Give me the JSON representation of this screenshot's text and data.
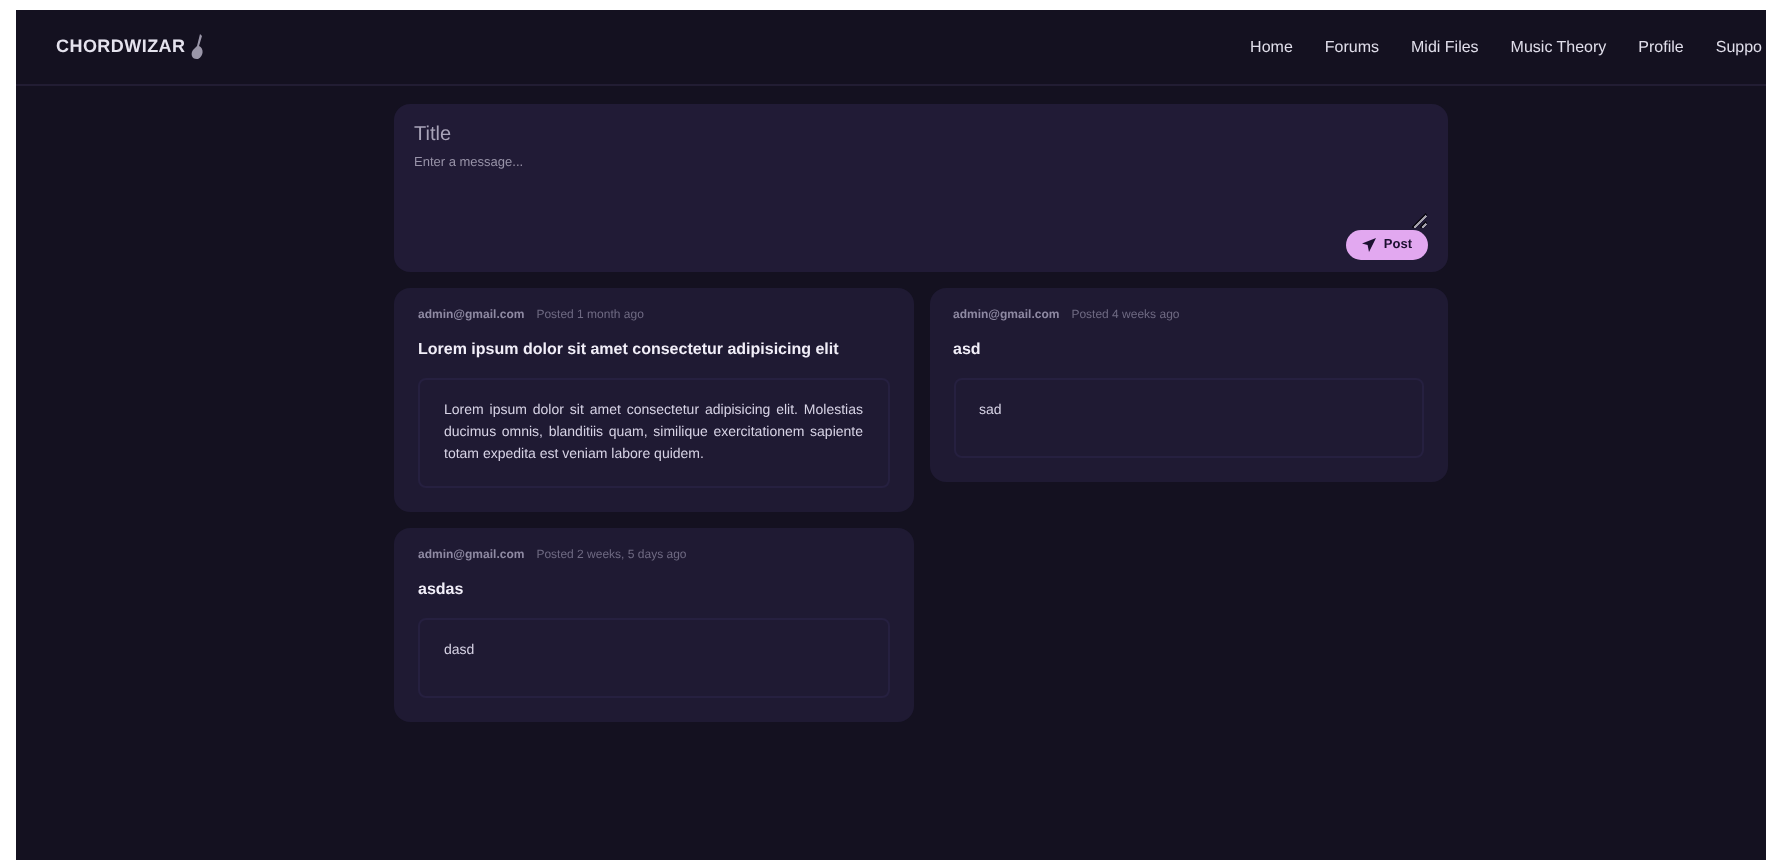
{
  "brand": {
    "name": "CHORDWIZAR"
  },
  "nav": [
    {
      "label": "Home"
    },
    {
      "label": "Forums"
    },
    {
      "label": "Midi Files"
    },
    {
      "label": "Music Theory"
    },
    {
      "label": "Profile"
    },
    {
      "label": "Suppo"
    }
  ],
  "composer": {
    "title_placeholder": "Title",
    "message_placeholder": "Enter a message...",
    "button": "Post"
  },
  "posts": [
    {
      "author": "admin@gmail.com",
      "time": "Posted 1 month ago",
      "title": "Lorem ipsum dolor sit amet consectetur adipisicing elit",
      "body": "Lorem ipsum dolor sit amet consectetur adipisicing elit. Molestias ducimus omnis, blanditiis quam, similique exercitationem sapiente totam expedita est veniam labore quidem."
    },
    {
      "author": "admin@gmail.com",
      "time": "Posted 4 weeks ago",
      "title": "asd",
      "body": "sad"
    },
    {
      "author": "admin@gmail.com",
      "time": "Posted 2 weeks, 5 days ago",
      "title": "asdas",
      "body": "dasd"
    }
  ]
}
